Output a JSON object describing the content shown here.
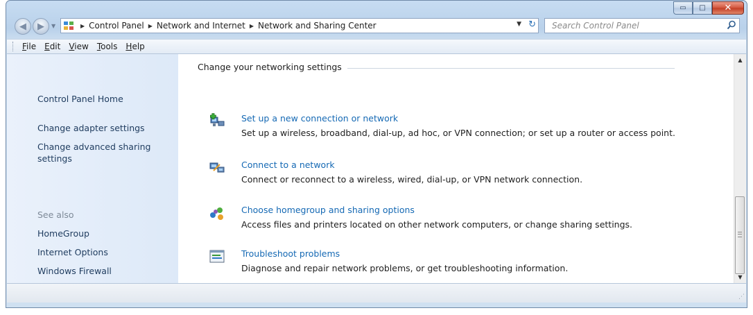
{
  "window": {
    "minimize_glyph": "▭",
    "maximize_glyph": "□",
    "close_glyph": "✕"
  },
  "navigation": {
    "breadcrumbs": [
      "Control Panel",
      "Network and Internet",
      "Network and Sharing Center"
    ],
    "search_placeholder": "Search Control Panel"
  },
  "menu": {
    "items": [
      {
        "accel": "F",
        "rest": "ile"
      },
      {
        "accel": "E",
        "rest": "dit"
      },
      {
        "accel": "V",
        "rest": "iew"
      },
      {
        "accel": "T",
        "rest": "ools"
      },
      {
        "accel": "H",
        "rest": "elp"
      }
    ]
  },
  "sidebar": {
    "home": "Control Panel Home",
    "adapter": "Change adapter settings",
    "advanced_line1": "Change advanced sharing",
    "advanced_line2": "settings",
    "see_also": "See also",
    "see_also_items": [
      "HomeGroup",
      "Internet Options",
      "Windows Firewall"
    ]
  },
  "main": {
    "section_title": "Change your networking settings",
    "tasks": [
      {
        "link": "Set up a new connection or network",
        "description": "Set up a wireless, broadband, dial-up, ad hoc, or VPN connection; or set up a router or access point.",
        "icon": "new-connection-icon"
      },
      {
        "link": "Connect to a network",
        "description": "Connect or reconnect to a wireless, wired, dial-up, or VPN network connection.",
        "icon": "connect-network-icon"
      },
      {
        "link": "Choose homegroup and sharing options",
        "description": "Access files and printers located on other network computers, or change sharing settings.",
        "icon": "homegroup-icon"
      },
      {
        "link": "Troubleshoot problems",
        "description": "Diagnose and repair network problems, or get troubleshooting information.",
        "icon": "troubleshoot-icon"
      }
    ]
  },
  "colors": {
    "link": "#1569b4",
    "sidebar_bg": "#e3eefa",
    "close_button": "#c8452c"
  }
}
